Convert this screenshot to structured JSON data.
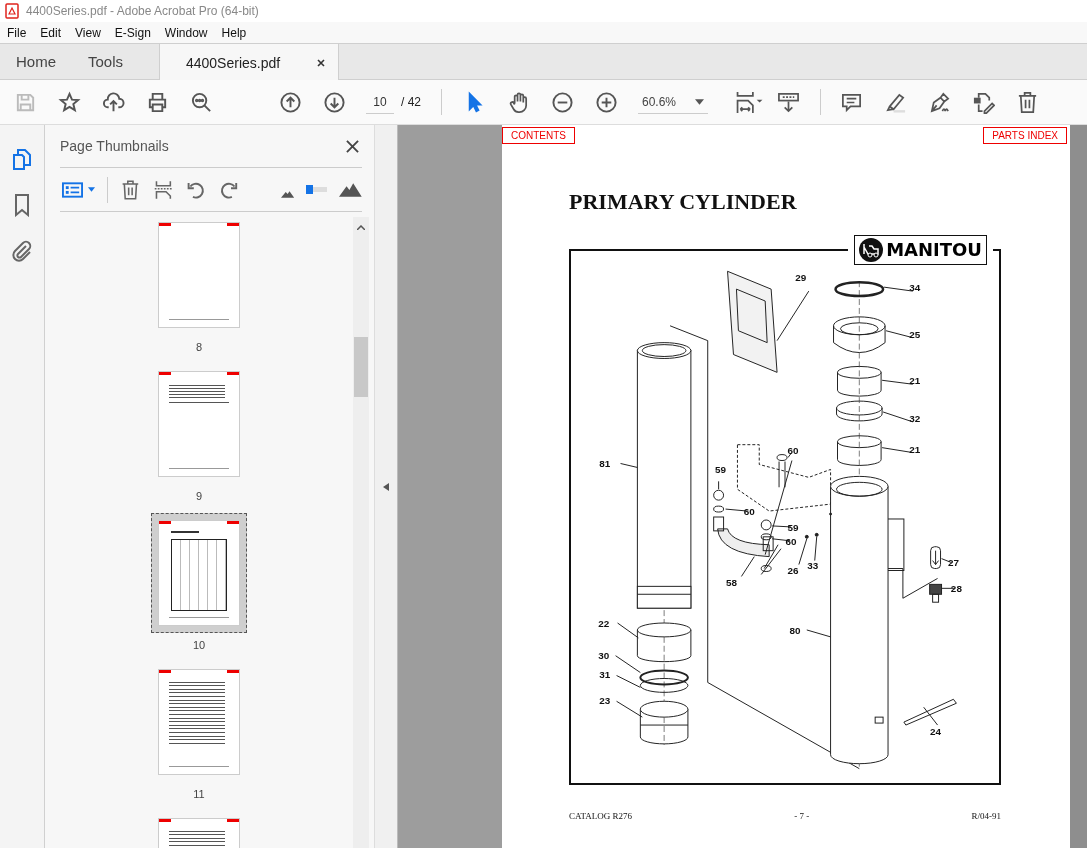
{
  "window": {
    "title": "4400Series.pdf - Adobe Acrobat Pro (64-bit)"
  },
  "menu": [
    "File",
    "Edit",
    "View",
    "E-Sign",
    "Window",
    "Help"
  ],
  "tabs": [
    {
      "label": "Home",
      "selected": false
    },
    {
      "label": "Tools",
      "selected": false
    },
    {
      "label": "4400Series.pdf",
      "selected": true
    }
  ],
  "file_actions": [
    {
      "kind": "save",
      "disabled": true
    },
    {
      "kind": "star",
      "disabled": false
    },
    {
      "kind": "upload",
      "disabled": false
    },
    {
      "kind": "print",
      "disabled": false
    },
    {
      "kind": "search",
      "disabled": false
    }
  ],
  "page_nav": {
    "page": "10",
    "total": "/ 42"
  },
  "tools": [
    {
      "kind": "select",
      "selected": true
    },
    {
      "kind": "hand",
      "selected": false
    }
  ],
  "zoom": {
    "value": "60.6%"
  },
  "rail": [
    {
      "kind": "pages",
      "selected": true
    },
    {
      "kind": "bookmarks",
      "selected": false
    },
    {
      "kind": "attachments",
      "selected": false
    }
  ],
  "panel": {
    "title": "Page Thumbnails",
    "thumbnail_size": {
      "level": 0.3
    },
    "thumbnails": [
      {
        "label": "8",
        "kind": "blank",
        "selected": false
      },
      {
        "label": "9",
        "kind": "table",
        "selected": false
      },
      {
        "label": "10",
        "kind": "drawing",
        "selected": true
      },
      {
        "label": "11",
        "kind": "list",
        "selected": false
      },
      {
        "kind": "list",
        "selected": false
      }
    ]
  },
  "document": {
    "links": [
      "CONTENTS",
      "PARTS INDEX"
    ],
    "title": "PRIMARY CYLINDER",
    "logo": "MANITOU",
    "callouts": [
      "29",
      "34",
      "25",
      "21",
      "32",
      "21",
      "60",
      "81",
      "59",
      "60",
      "59",
      "60",
      "27",
      "26",
      "33",
      "28",
      "58",
      "22",
      "80",
      "30",
      "31",
      "23",
      "24"
    ],
    "footer": {
      "left": "CATALOG R276",
      "center": "- 7 -",
      "right": "R/04-91"
    }
  }
}
